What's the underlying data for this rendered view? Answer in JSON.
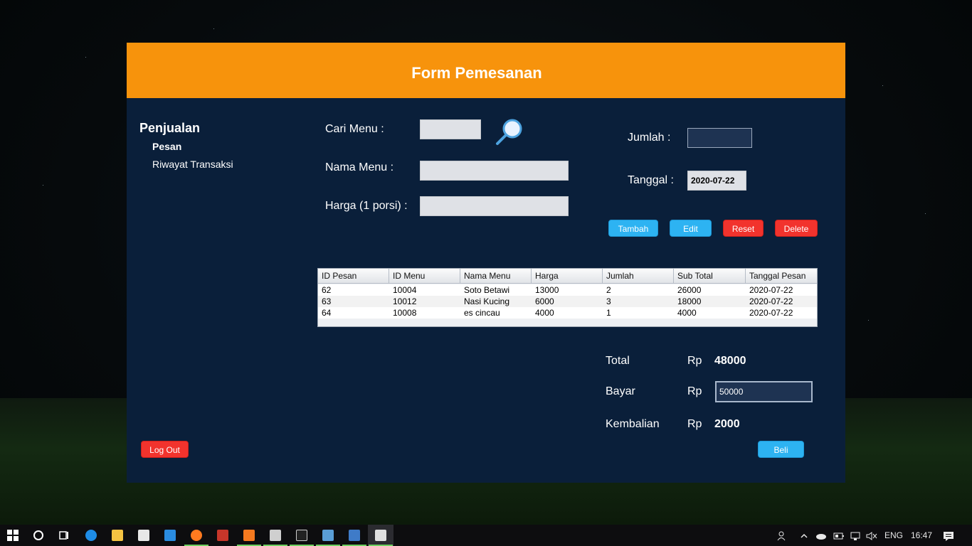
{
  "window": {
    "title": "Form Pemesanan"
  },
  "sidebar": {
    "title": "Penjualan",
    "items": [
      {
        "label": "Pesan"
      },
      {
        "label": "Riwayat Transaksi"
      }
    ],
    "logout_label": "Log Out"
  },
  "form": {
    "search_label": "Cari Menu :",
    "search_value": "",
    "nama_menu_label": "Nama Menu :",
    "nama_menu_value": "",
    "harga_label": "Harga (1 porsi) :",
    "harga_value": "",
    "jumlah_label": "Jumlah :",
    "jumlah_value": "",
    "tanggal_label": "Tanggal :",
    "tanggal_value": "2020-07-22"
  },
  "buttons": {
    "tambah": "Tambah",
    "edit": "Edit",
    "reset": "Reset",
    "delete": "Delete",
    "beli": "Beli"
  },
  "table": {
    "columns": [
      "ID Pesan",
      "ID Menu",
      "Nama Menu",
      "Harga",
      "Jumlah",
      "Sub Total",
      "Tanggal Pesan"
    ],
    "rows": [
      [
        "62",
        "10004",
        "Soto Betawi",
        "13000",
        "2",
        "26000",
        "2020-07-22"
      ],
      [
        "63",
        "10012",
        "Nasi Kucing",
        "6000",
        "3",
        "18000",
        "2020-07-22"
      ],
      [
        "64",
        "10008",
        "es cincau",
        "4000",
        "1",
        "4000",
        "2020-07-22"
      ]
    ]
  },
  "summary": {
    "total_label": "Total",
    "bayar_label": "Bayar",
    "kembalian_label": "Kembalian",
    "currency": "Rp",
    "total_value": "48000",
    "bayar_value": "50000",
    "kembalian_value": "2000"
  },
  "taskbar": {
    "language": "ENG",
    "time": "16:47",
    "apps": [
      "start-icon",
      "cortana-icon",
      "task-view-icon",
      "edge-icon",
      "file-explorer-icon",
      "store-icon",
      "vscode-icon",
      "firefox-icon",
      "filezilla-icon",
      "xampp-icon",
      "printer-app-icon",
      "cmd-icon",
      "remote-desktop-icon",
      "virtualbox-icon",
      "java-icon"
    ]
  },
  "colors": {
    "header": "#f7930c",
    "panel": "#0a1f3a",
    "button_blue": "#2db3f2",
    "button_red": "#f2332d"
  }
}
